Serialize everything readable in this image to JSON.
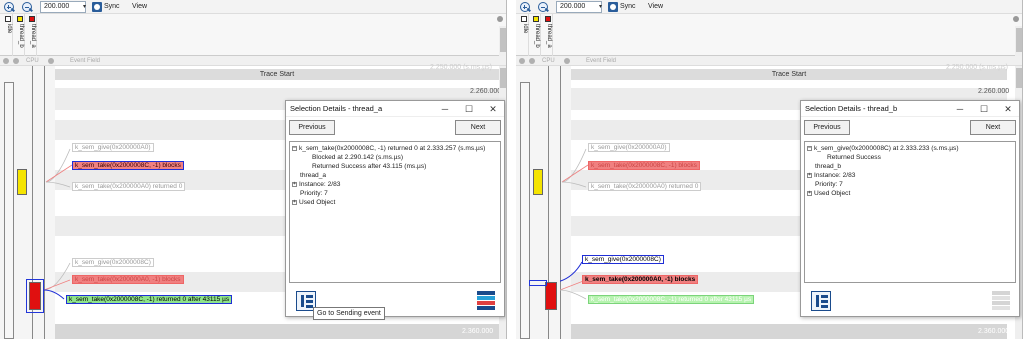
{
  "toolbar": {
    "zoom_value": "200.000",
    "sync_label": "Sync",
    "view_label": "View"
  },
  "header": {
    "columns": [
      {
        "label": "idle",
        "color": "#ffffff"
      },
      {
        "label": "thread_b",
        "color": "#f5e400"
      },
      {
        "label": "thread_a",
        "color": "#e01010"
      }
    ]
  },
  "colbar": {
    "cpu_label": "CPU",
    "event_field_label": "Event Field"
  },
  "timeline": {
    "trace_start": "Trace Start",
    "time_top": "2.250.000 (s.ms.µs)",
    "time_260": "2.260.000",
    "time_bottom": "2.360.000"
  },
  "left": {
    "events": {
      "give_a": "k_sem_give(0x200000A0)",
      "take_c": "k_sem_take(0x2000008C, -1) blocks",
      "take_a_ret": "k_sem_take(0x200000A0) returned 0",
      "give_c": "k_sem_give(0x2000008C)",
      "take_a_blocks": "k_sem_take(0x200000A0, -1) blocks",
      "take_c_ret": "k_sem_take(0x2000008C, -1) returned 0 after 43115 µs"
    },
    "dialog": {
      "title": "Selection Details - thread_a",
      "previous": "Previous",
      "next": "Next",
      "tree": [
        "k_sem_take(0x2000008C, -1) returned 0 at 2.333.257 (s.ms.µs)",
        "Blocked at 2.290.142 (s.ms.µs)",
        "Returned Success after 43.115 (ms.µs)",
        "thread_a",
        "Instance: 2/83",
        "Priority: 7",
        "Used Object"
      ],
      "tooltip": "Go to Sending event"
    }
  },
  "right": {
    "events": {
      "give_a": "k_sem_give(0x200000A0)",
      "take_c": "k_sem_take(0x2000008C, -1) blocks",
      "take_a_ret": "k_sem_take(0x200000A0) returned 0",
      "give_c": "k_sem_give(0x2000008C)",
      "take_a_blocks": "k_sem_take(0x200000A0, -1) blocks",
      "take_c_ret": "k_sem_take(0x2000008C, -1) returned 0 after 43115 µs"
    },
    "dialog": {
      "title": "Selection Details - thread_b",
      "previous": "Previous",
      "next": "Next",
      "tree": [
        "k_sem_give(0x2000008C) at 2.333.233 (s.ms.µs)",
        "Returned Success",
        "thread_b",
        "Instance: 2/83",
        "Priority: 7",
        "Used Object"
      ]
    }
  }
}
